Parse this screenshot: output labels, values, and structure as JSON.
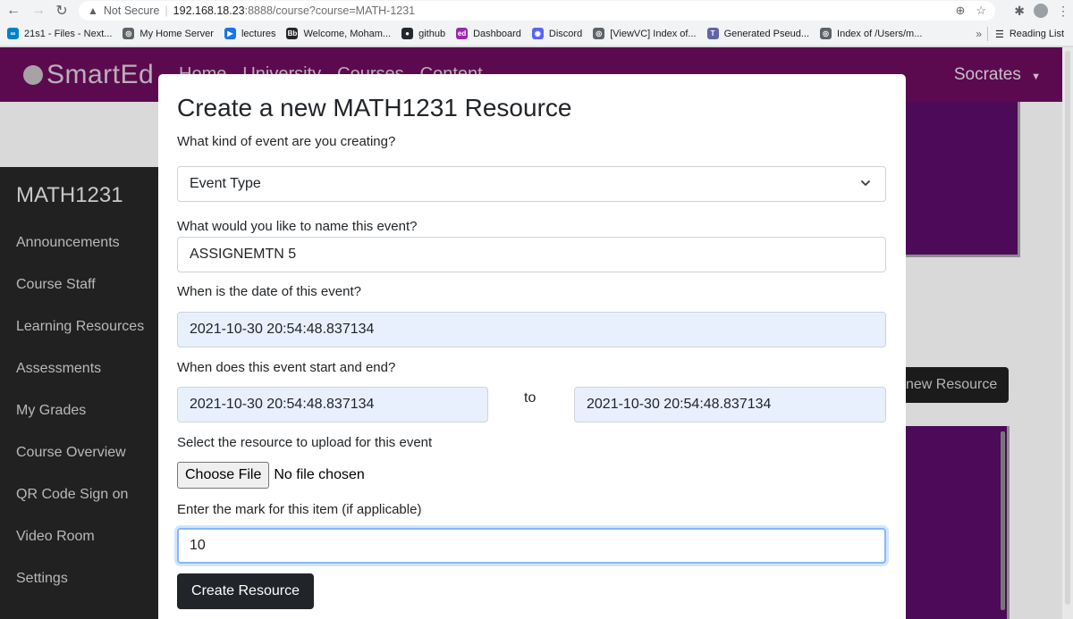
{
  "browser": {
    "security_label": "Not Secure",
    "url_host": "192.168.18.23",
    "url_rest": ":8888/course?course=MATH-1231",
    "bookmarks": [
      {
        "label": "21s1 - Files - Next...",
        "icon": "nextcloud-icon",
        "color": "#0082c9"
      },
      {
        "label": "My Home Server",
        "icon": "globe-icon",
        "color": "#5f6368"
      },
      {
        "label": "lectures",
        "icon": "play-circle-icon",
        "color": "#1a73e8"
      },
      {
        "label": "Welcome, Moham...",
        "icon": "bb-icon",
        "color": "#262626"
      },
      {
        "label": "github",
        "icon": "github-icon",
        "color": "#24292f"
      },
      {
        "label": "Dashboard",
        "icon": "ed-icon",
        "color": "#9c27b0"
      },
      {
        "label": "Discord",
        "icon": "discord-icon",
        "color": "#5865f2"
      },
      {
        "label": "[ViewVC] Index of...",
        "icon": "globe-icon",
        "color": "#5f6368"
      },
      {
        "label": "Generated Pseud...",
        "icon": "teams-icon",
        "color": "#6264a7"
      },
      {
        "label": "Index of /Users/m...",
        "icon": "globe-icon",
        "color": "#5f6368"
      }
    ],
    "more_label": "»",
    "reading_list_label": "Reading List"
  },
  "site": {
    "logo_text": "SmartEd",
    "nav_links": [
      "Home",
      "University",
      "Courses",
      "Content"
    ],
    "user_name": "Socrates",
    "accent_color": "#5c0a4f"
  },
  "sidebar": {
    "course_code": "MATH1231",
    "items": [
      "Announcements",
      "Course Staff",
      "Learning Resources",
      "Assessments",
      "My Grades",
      "Course Overview",
      "QR Code Sign on",
      "Video Room",
      "Settings"
    ]
  },
  "background": {
    "button_label": "new Resource"
  },
  "modal": {
    "title": "Create a new MATH1231 Resource",
    "event_type_question": "What kind of event are you creating?",
    "event_type_value": "Event Type",
    "name_question": "What would you like to name this event?",
    "name_value": "ASSIGNEMTN 5",
    "date_question": "When is the date of this event?",
    "date_value": "2021-10-30 20:54:48.837134",
    "range_question": "When does this event start and end?",
    "start_value": "2021-10-30 20:54:48.837134",
    "to_label": "to",
    "end_value": "2021-10-30 20:54:48.837134",
    "upload_question": "Select the resource to upload for this event",
    "choose_file_label": "Choose File",
    "no_file_label": "No file chosen",
    "mark_question": "Enter the mark for this item (if applicable)",
    "mark_value": "10",
    "submit_label": "Create Resource"
  }
}
